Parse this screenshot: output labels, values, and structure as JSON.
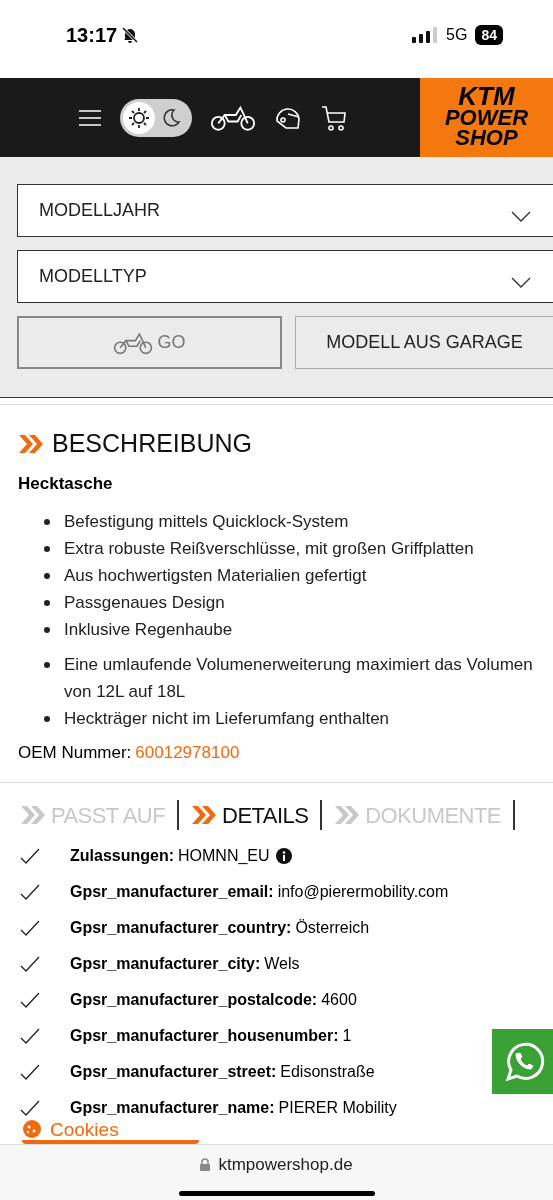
{
  "status_bar": {
    "time": "13:17",
    "network": "5G",
    "battery": "84",
    "silent": true
  },
  "header": {
    "dark_mode": false,
    "logo": [
      "KTM",
      "POWER",
      "SHOP"
    ]
  },
  "filters": {
    "selects": [
      {
        "placeholder": "MODELLJAHR"
      },
      {
        "placeholder": "MODELLTYP"
      }
    ],
    "go_button": {
      "label": "GO",
      "disabled": true
    },
    "garage_button": {
      "label": "MODELL AUS GARAGE"
    }
  },
  "description": {
    "title": "BESCHREIBUNG",
    "product": "Hecktasche",
    "lists": [
      [
        "Befestigung mittels Quicklock-System",
        "Extra robuste Reißverschlüsse, mit großen Griffplatten",
        "Aus hochwertigsten Materialien gefertigt",
        "Passgenaues Design",
        "Inklusive Regenhaube"
      ],
      [
        "Eine umlaufende Volumenerweiterung maximiert das Volumen von 12L auf 18L",
        "Heckträger nicht im Lieferumfang enthalten"
      ]
    ],
    "oem_label": "OEM Nummer:",
    "oem_number": "60012978100"
  },
  "tabs": [
    {
      "label": "PASST AUF",
      "selected": false
    },
    {
      "label": "DETAILS",
      "selected": true
    },
    {
      "label": "DOKUMENTE",
      "selected": false
    }
  ],
  "details": [
    {
      "label": "Zulassungen:",
      "value": "HOMNN_EU",
      "info": true
    },
    {
      "label": "Gpsr_manufacturer_email:",
      "value": "info@pierermobility.com",
      "info": false
    },
    {
      "label": "Gpsr_manufacturer_country:",
      "value": "Österreich",
      "info": false
    },
    {
      "label": "Gpsr_manufacturer_city:",
      "value": "Wels",
      "info": false
    },
    {
      "label": "Gpsr_manufacturer_postalcode:",
      "value": "4600",
      "info": false
    },
    {
      "label": "Gpsr_manufacturer_housenumber:",
      "value": "1",
      "info": false
    },
    {
      "label": "Gpsr_manufacturer_street:",
      "value": "Edisonstraße",
      "info": false
    },
    {
      "label": "Gpsr_manufacturer_name:",
      "value": "PIERER Mobility",
      "info": false
    }
  ],
  "cookies_button": "Cookies",
  "address_bar": {
    "url": "ktmpowershop.de"
  }
}
